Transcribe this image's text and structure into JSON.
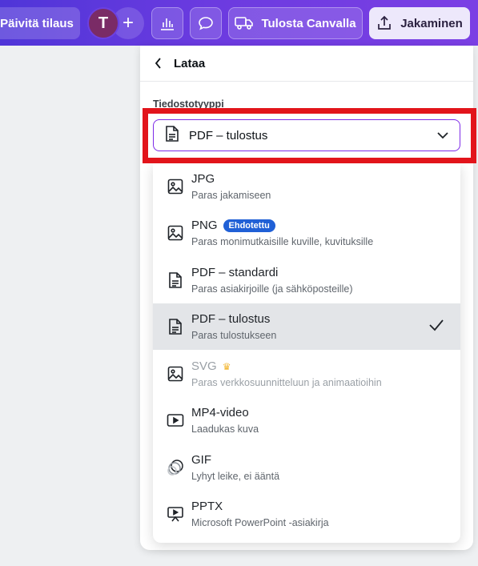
{
  "toolbar": {
    "upgrade_label": "Päivitä tilaus",
    "avatar_initial": "T",
    "add_label": "+",
    "print_label": "Tulosta Canvalla",
    "share_label": "Jakaminen"
  },
  "panel": {
    "back_title": "Lataa",
    "file_type_label": "Tiedostotyyppi",
    "selected_value": "PDF – tulostus"
  },
  "options": [
    {
      "title": "JPG",
      "desc": "Paras jakamiseen",
      "icon": "image-icon"
    },
    {
      "title": "PNG",
      "badge": "Ehdotettu",
      "desc": "Paras monimutkaisille kuville, kuvituksille",
      "icon": "image-icon"
    },
    {
      "title": "PDF – standardi",
      "desc": "Paras asiakirjoille (ja sähköposteille)",
      "icon": "document-icon"
    },
    {
      "title": "PDF – tulostus",
      "desc": "Paras tulostukseen",
      "icon": "document-icon",
      "selected": true
    },
    {
      "title": "SVG",
      "crown": "♛",
      "desc": "Paras verkkosuunnitteluun ja animaatioihin",
      "icon": "image-icon",
      "disabled": true
    },
    {
      "title": "MP4-video",
      "desc": "Laadukas kuva",
      "icon": "video-icon"
    },
    {
      "title": "GIF",
      "desc": "Lyhyt leike, ei ääntä",
      "icon": "gif-icon"
    },
    {
      "title": "PPTX",
      "desc": "Microsoft PowerPoint -asiakirja",
      "icon": "presentation-icon"
    }
  ],
  "colors": {
    "toolbar_gradient_start": "#4f35d8",
    "toolbar_gradient_end": "#7b3fe4",
    "select_border": "#7d2ae8",
    "highlight": "#e2141b",
    "badge": "#2060d6",
    "selected_row": "#e3e5e8"
  }
}
